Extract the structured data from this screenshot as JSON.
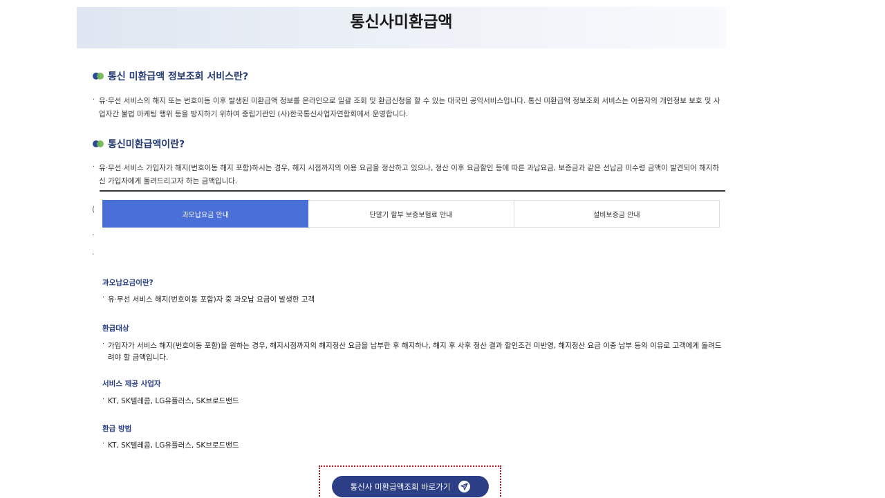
{
  "banner": {
    "title": "통신사미환급액"
  },
  "sections": [
    {
      "heading": "통신 미환급액 정보조회 서비스란?",
      "bullet": "·",
      "text": "유·무선 서비스의 해지 또는 번호이동 이후 발생된 미환급액 정보를 온라인으로 일괄 조회 및 환급신청을 할 수 있는 대국민 공익서비스입니다. 통신 미환급액 정보조회 서비스는 이용자의 개인정보 보호 및 사업자간 불법 마케팅 행위 등을 방지하기 위하여 중립기관인 (사)한국통신사업자연합회에서 운영합니다."
    },
    {
      "heading": "통신미환급액이란?",
      "bullet": "·",
      "text": "유·무선 서비스 가입자가 해지(번호이동 해지 포함)하시는 경우, 해지 시점까지의 이용 요금을 정산하고 있으나, 정산 이후 요금할인 등에 따른 과납요금, 보증금과 같은 선납금 미수령 금액이 발견되어 해지하신 가입자에게 돌려드리고자 하는 금액입니다."
    }
  ],
  "tabs": [
    {
      "label": "과오납요금 안내",
      "active": true
    },
    {
      "label": "단말기 할부 보증보험료 안내",
      "active": false
    },
    {
      "label": "설비보증금 안내",
      "active": false
    }
  ],
  "content": {
    "blocks": [
      {
        "heading": "과오납요금이란?",
        "bullet": "·",
        "text": "유·무선 서비스 해지(번호이동 포함)자 중 과오납 요금이 발생한 고객"
      },
      {
        "heading": "환급대상",
        "bullet": "·",
        "text": "가입자가 서비스 해지(번호이동 포함)을 원하는 경우, 해지시점까지의 해지정산 요금을 납부한 후 해지하나, 해지 후 사후 정산 결과 할인조건 미반영, 해지정산 요금 이중 납부 등의 이유로 고객에게 돌려드려야 할 금액입니다."
      },
      {
        "heading": "서비스 제공 사업자",
        "bullet": "·",
        "text": "KT, SK텔레콤, LG유플러스, SK브로드밴드"
      },
      {
        "heading": "환급 방법",
        "bullet": "·",
        "text": "KT, SK텔레콤, LG유플러스, SK브로드밴드"
      }
    ]
  },
  "cta": {
    "label": "통신사 미환급액조회 바로가기",
    "icon": "paper-plane-icon",
    "frame_color": "#b3121d"
  },
  "colors": {
    "tab_active": "#4a6fd6",
    "heading": "#243b73",
    "cta_bg": "#2c3f86"
  }
}
